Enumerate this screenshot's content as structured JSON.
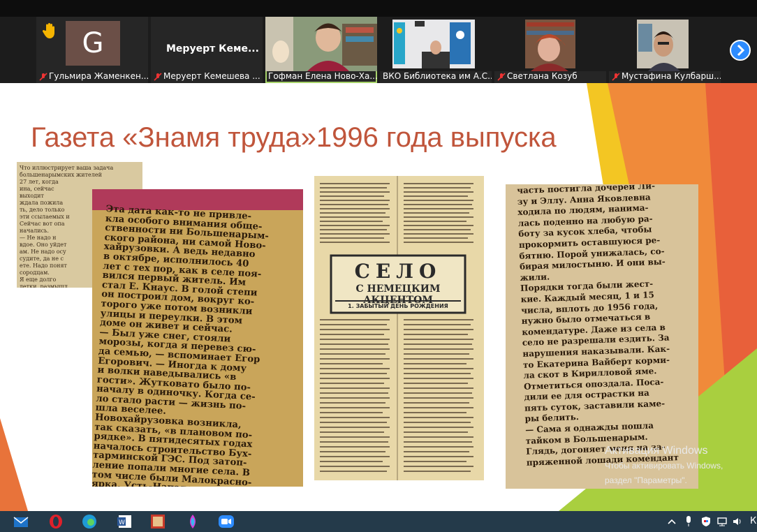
{
  "participants": [
    {
      "name": "Гульмира Жаменкен...",
      "avatar_letter": "G",
      "hand_raised": true,
      "muted": true
    },
    {
      "name": "Меруерт Кемешева ...",
      "display_text": "Меруерт Кеме...",
      "muted": true
    },
    {
      "name": "Гофман Елена Ново-Ха...",
      "active_speaker": true,
      "muted": false
    },
    {
      "name": "ВКО Библиотека им А.С...",
      "muted": false
    },
    {
      "name": "Светлана Козуб",
      "muted": true
    },
    {
      "name": "Мустафина Кулбарш...",
      "muted": true
    }
  ],
  "slide": {
    "title": "Газета «Знамя труда»1996 года выпуска",
    "headline_main": "СЕЛО",
    "headline_sub": "С НЕМЕЦКИМ АКЦЕНТОМ",
    "headline_caption": "1. ЗАБЫТЫЙ ДЕНЬ РОЖДЕНИЯ",
    "clip2_text": [
      "Эта дата как-то не привле-",
      "кла особого внимания обще-",
      "ственности ни Большенарым-",
      "ского района, ни самой Ново-",
      "хайрузовки. А ведь недавно",
      "в октябре, исполнилось 40",
      "лет с тех пор, как в селе поя-",
      "вился первый житель. Им",
      "стал Е. Кнаус. В голой степи",
      "он построил дом, вокруг ко-",
      "торого уже потом возникли",
      "улицы и переулки. В этом",
      "доме он живет и сейчас.",
      "— Был уже снег, стояли",
      "морозы, когда я перевез сю-",
      "да семью, — вспоминает Егор",
      "Егорович. — Иногда к дому",
      "и волки наведывались «в",
      "гости». Жутковато было по-",
      "началу в одиночку. Когда се-",
      "ло стало расти — жизнь по-",
      "шла веселее.",
      "Новохайрузовка возникла,",
      "так сказать, «в плановом по-",
      "рядке». В пятидесятых годах",
      "началось строительство Бух-",
      "тарминской ГЭС. Под затоп-",
      "ление попали многие села. В",
      "том числе были Малокрасно-",
      "ярка, Усть-Напаловка"
    ],
    "clip4_text": [
      "часть постигла дочерей Ли-",
      "зу и Эллу. Анна Яковлевна",
      "ходила по людям, нанима-",
      "лась поденно на любую ра-",
      "боту за кусок хлеба, чтобы",
      "прокормить оставшуюся ре-",
      "бятню. Порой унижалась, со-",
      "бирая милостыню. И они вы-",
      "жили.",
      "Порядки тогда были жест-",
      "кие. Каждый месяц, 1 и 15",
      "числа, вплоть до 1956 года,",
      "нужно было отмечаться в",
      "комендатуре. Даже из села в",
      "село не разрешали ездить. За",
      "нарушения наказывали. Как-",
      "то Екатерина Вайберт корми-",
      "ла скот в Кирилловой яме.",
      "Отметиться опоздала. Поса-",
      "дили ее для острастки на",
      "пять суток, заставили каме-",
      "ры белить.",
      "— Сама я однажды пошла",
      "тайком в Большенарым.",
      "Глядь, догоняет меня на за-",
      "пряженной лошади комендант"
    ],
    "clip1_text": [
      "Что иллюстрирует ваша задача",
      "большенарымских жителей",
      "27 лет, когда",
      "ина, сейчас",
      "выходит",
      "ждала пожила",
      "ть, дело только",
      "эти ссылаемых и",
      "Сейчас вот опа",
      "начались.",
      "— Не надо н",
      "вдое. Оно уйдет",
      "ам. Не надо осу",
      "судите, да не с",
      "ете. Надо понят",
      "сородцам.",
      "Я еще долго",
      "детки, размышл"
    ]
  },
  "watermark": {
    "title": "Активация Windows",
    "line1": "Чтобы активировать Windows,",
    "line2": "раздел \"Параметры\"."
  },
  "taskbar": {
    "apps": [
      "mail-icon",
      "opera-icon",
      "edge-icon",
      "word-icon",
      "image-viewer-icon",
      "paint-icon",
      "zoom-icon"
    ],
    "tray_letter": "К"
  },
  "colors": {
    "title": "#c0553b",
    "accent_orange": "#e8733a",
    "accent_yellow": "#f3c623",
    "accent_green": "#a9cf3f",
    "zoom_blue": "#2d8cff",
    "taskbar": "#243a4a"
  }
}
